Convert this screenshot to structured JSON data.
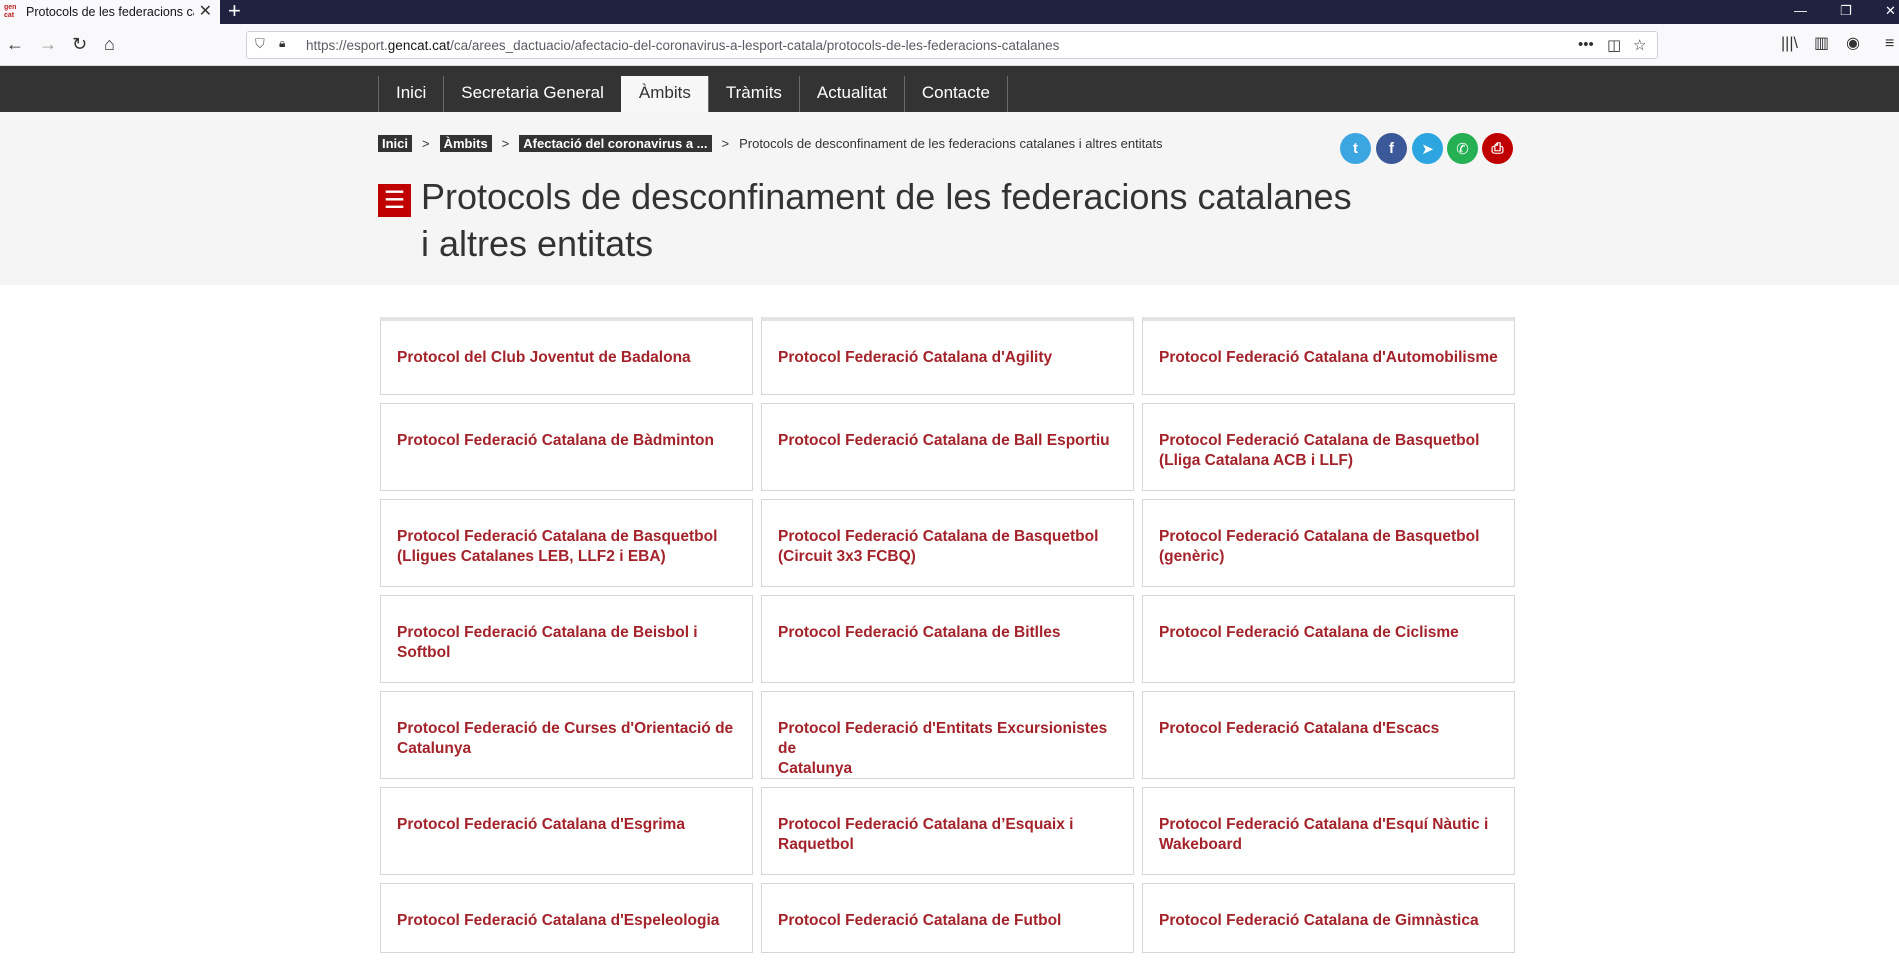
{
  "browser": {
    "tab_title": "Protocols de les federacions cat",
    "tab_favicon_text": "gen\ncat",
    "url_prefix": "https://esport.",
    "url_domain": "gencat.cat",
    "url_path": "/ca/arees_dactuacio/afectacio-del-coronavirus-a-lesport-catala/protocols-de-les-federacions-catalanes",
    "icons": [
      "back-icon",
      "forward-icon",
      "reload-icon",
      "home-icon",
      "shield-icon",
      "lock-icon",
      "more-icon",
      "pocket-icon",
      "bookmark-star-icon",
      "library-icon",
      "sidebar-icon",
      "account-icon",
      "menu-icon"
    ]
  },
  "site_nav": {
    "items": [
      {
        "label": "Inici"
      },
      {
        "label": "Secretaria General"
      },
      {
        "label": "Àmbits"
      },
      {
        "label": "Tràmits"
      },
      {
        "label": "Actualitat"
      },
      {
        "label": "Contacte"
      }
    ],
    "active_index": 2
  },
  "breadcrumb": {
    "items": [
      "Inici",
      "Àmbits",
      "Afectació del coronavirus a ..."
    ],
    "separator": ">",
    "current": "Protocols de desconfinament de les federacions catalanes i altres entitats"
  },
  "share": {
    "colors": {
      "twitter": "#3ca6e0",
      "facebook": "#3b5998",
      "telegram": "#2ca5e0",
      "whatsapp": "#25b054",
      "print": "#c00000"
    }
  },
  "page": {
    "title_line1": "Protocols de desconfinament de les federacions catalanes",
    "title_line2": "i altres entitats",
    "accent_color": "#c00000"
  },
  "cards": {
    "rows": [
      [
        {
          "line1": "Protocol del Club Joventut de Badalona",
          "line2": "",
          "height": 78
        },
        {
          "line1": "Protocol Federació Catalana d'Agility",
          "line2": "",
          "height": 78
        },
        {
          "line1": "Protocol Federació Catalana d'Automobilisme",
          "line2": "",
          "height": 78
        }
      ],
      [
        {
          "line1": "Protocol Federació Catalana de Bàdminton",
          "line2": "",
          "height": 88
        },
        {
          "line1": "Protocol Federació Catalana de Ball Esportiu",
          "line2": "",
          "height": 88
        },
        {
          "line1": "Protocol Federació Catalana de Basquetbol",
          "line2": "(Lliga Catalana ACB i LLF)",
          "height": 88
        }
      ],
      [
        {
          "line1": "Protocol Federació Catalana de Basquetbol",
          "line2": "(Lligues Catalanes LEB, LLF2 i EBA)",
          "height": 88
        },
        {
          "line1": "Protocol Federació Catalana de Basquetbol",
          "line2": "(Circuit 3x3 FCBQ)",
          "height": 88
        },
        {
          "line1": "Protocol Federació Catalana de Basquetbol",
          "line2": "(genèric)",
          "height": 88
        }
      ],
      [
        {
          "line1": "Protocol Federació Catalana de Beisbol i",
          "line2": "Softbol",
          "height": 88
        },
        {
          "line1": "Protocol Federació Catalana de Bitlles",
          "line2": "",
          "height": 88
        },
        {
          "line1": "Protocol Federació Catalana de Ciclisme",
          "line2": "",
          "height": 88
        }
      ],
      [
        {
          "line1": "Protocol Federació de Curses d'Orientació de",
          "line2": "Catalunya",
          "height": 88
        },
        {
          "line1": "Protocol Federació d'Entitats Excursionistes de",
          "line2": "Catalunya",
          "height": 88
        },
        {
          "line1": "Protocol Federació Catalana d'Escacs",
          "line2": "",
          "height": 88
        }
      ],
      [
        {
          "line1": "Protocol Federació Catalana d'Esgrima",
          "line2": "",
          "height": 88
        },
        {
          "line1": "Protocol Federació Catalana d’Esquaix i",
          "line2": "Raquetbol",
          "height": 88
        },
        {
          "line1": "Protocol Federació Catalana d'Esquí Nàutic i",
          "line2": "Wakeboard",
          "height": 88
        }
      ],
      [
        {
          "line1": "Protocol Federació Catalana d'Espeleologia",
          "line2": "",
          "height": 70
        },
        {
          "line1": "Protocol Federació Catalana de Futbol",
          "line2": "",
          "height": 70
        },
        {
          "line1": "Protocol Federació Catalana de Gimnàstica",
          "line2": "",
          "height": 70
        }
      ]
    ]
  }
}
